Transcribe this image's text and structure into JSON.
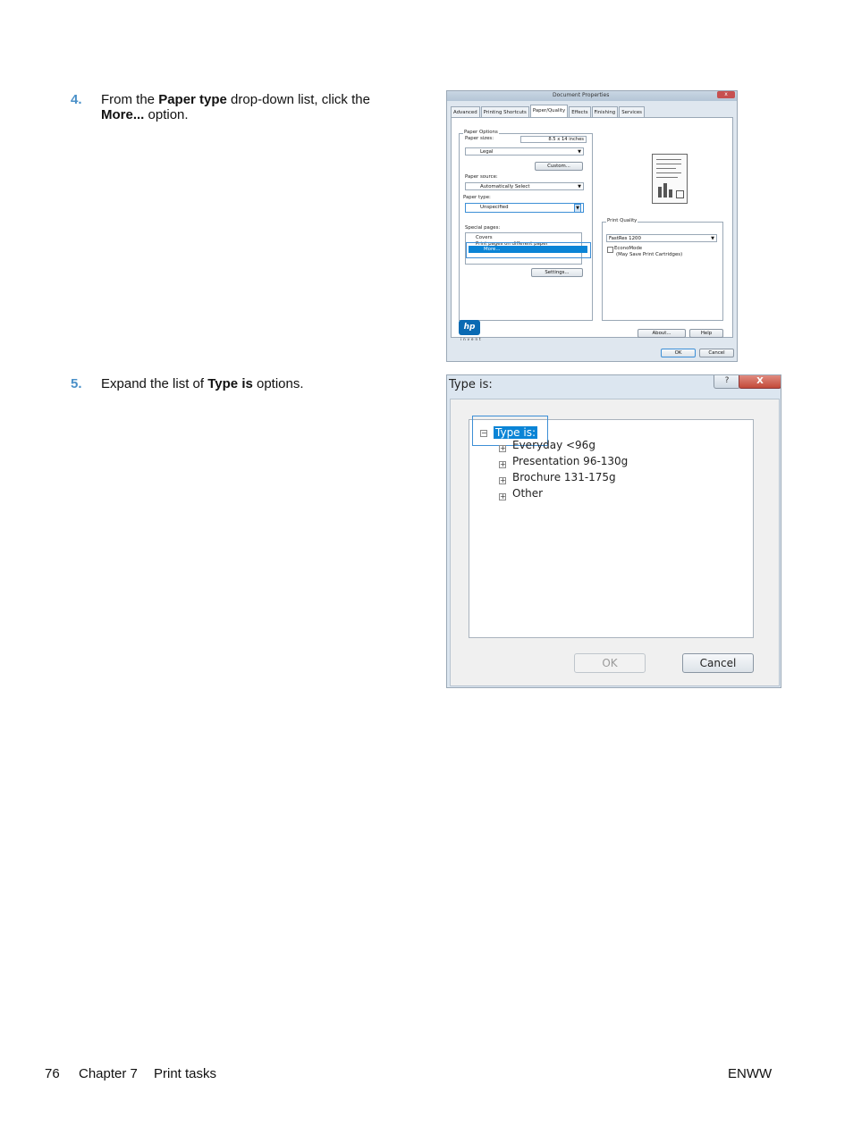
{
  "steps": [
    {
      "number": "4.",
      "pre": "From the ",
      "bold1": "Paper type",
      "mid": " drop-down list, click the ",
      "bold2": "More...",
      "post": " option."
    },
    {
      "number": "5.",
      "pre": "Expand the list of ",
      "bold1": "Type is",
      "post": " options."
    }
  ],
  "screenshot1": {
    "title": "Document Properties",
    "close": "x",
    "tabs": [
      "Advanced",
      "Printing Shortcuts",
      "Paper/Quality",
      "Effects",
      "Finishing",
      "Services"
    ],
    "paper_options_label": "Paper Options",
    "paper_sizes_label": "Paper sizes:",
    "paper_size_dims": "8.5 x 14 inches",
    "paper_size_value": "Legal",
    "custom_button": "Custom...",
    "paper_source_label": "Paper source:",
    "paper_source_value": "Automatically Select",
    "paper_type_label": "Paper type:",
    "paper_type_value": "Unspecified",
    "more_option": "More...",
    "special_pages_label": "Special pages:",
    "special_pages_item1": "Covers",
    "special_pages_item2": "Print pages on different paper",
    "settings_button": "Settings...",
    "print_quality_label": "Print Quality",
    "print_quality_value": "FastRes 1200",
    "economode_label": "EconoMode",
    "economode_note": "(May Save Print Cartridges)",
    "hp_logo": "hp",
    "hp_tagline": "invent",
    "about_button": "About...",
    "help_button": "Help",
    "ok_button": "OK",
    "cancel_button": "Cancel"
  },
  "screenshot2": {
    "title": "Type is:",
    "help_glyph": "?",
    "close_glyph": "X",
    "root": "Type is:",
    "children": [
      "Everyday <96g",
      "Presentation 96-130g",
      "Brochure 131-175g",
      "Other"
    ],
    "ok_button": "OK",
    "cancel_button": "Cancel"
  },
  "footer": {
    "page_number": "76",
    "chapter": "Chapter 7",
    "section": "Print tasks",
    "right": "ENWW"
  }
}
